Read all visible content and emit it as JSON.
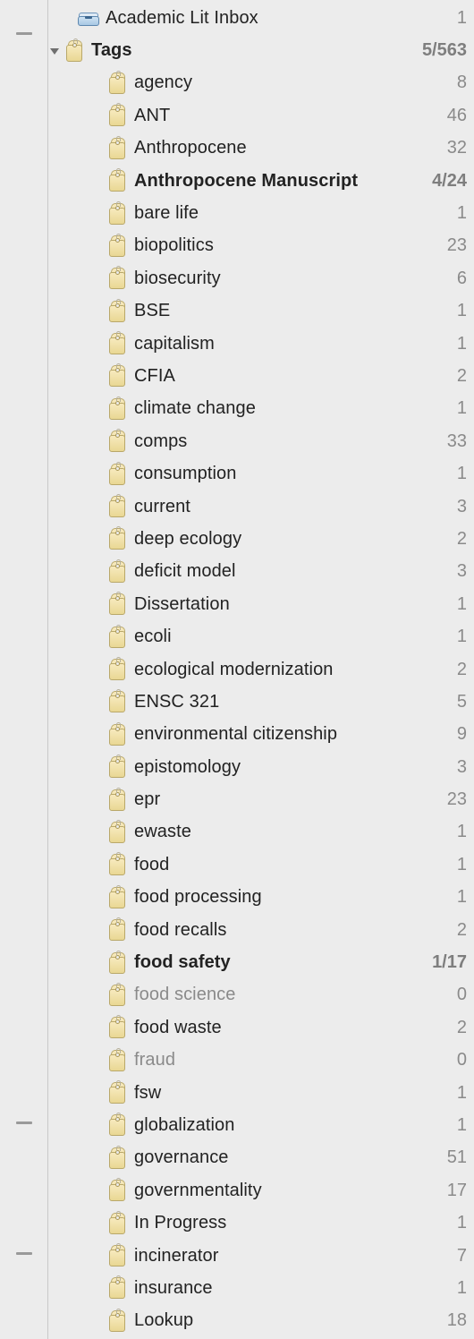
{
  "inboxRow": {
    "label": "Academic Lit Inbox",
    "count": "1",
    "iconName": "inbox-icon"
  },
  "tagsHeader": {
    "label": "Tags",
    "count": "5/563",
    "iconName": "tag-icon",
    "bold": true,
    "expanded": true
  },
  "tags": [
    {
      "label": "agency",
      "count": "8"
    },
    {
      "label": "ANT",
      "count": "46"
    },
    {
      "label": "Anthropocene",
      "count": "32"
    },
    {
      "label": "Anthropocene Manuscript",
      "count": "4/24",
      "bold": true
    },
    {
      "label": "bare life",
      "count": "1"
    },
    {
      "label": "biopolitics",
      "count": "23"
    },
    {
      "label": "biosecurity",
      "count": "6"
    },
    {
      "label": "BSE",
      "count": "1"
    },
    {
      "label": "capitalism",
      "count": "1"
    },
    {
      "label": "CFIA",
      "count": "2"
    },
    {
      "label": "climate change",
      "count": "1"
    },
    {
      "label": "comps",
      "count": "33"
    },
    {
      "label": "consumption",
      "count": "1"
    },
    {
      "label": "current",
      "count": "3"
    },
    {
      "label": "deep ecology",
      "count": "2"
    },
    {
      "label": "deficit model",
      "count": "3"
    },
    {
      "label": "Dissertation",
      "count": "1"
    },
    {
      "label": "ecoli",
      "count": "1"
    },
    {
      "label": "ecological modernization",
      "count": "2"
    },
    {
      "label": "ENSC 321",
      "count": "5"
    },
    {
      "label": "environmental citizenship",
      "count": "9"
    },
    {
      "label": "epistomology",
      "count": "3"
    },
    {
      "label": "epr",
      "count": "23"
    },
    {
      "label": "ewaste",
      "count": "1"
    },
    {
      "label": "food",
      "count": "1"
    },
    {
      "label": "food processing",
      "count": "1"
    },
    {
      "label": "food recalls",
      "count": "2"
    },
    {
      "label": "food safety",
      "count": "1/17",
      "bold": true
    },
    {
      "label": "food science",
      "count": "0",
      "dim": true
    },
    {
      "label": "food waste",
      "count": "2"
    },
    {
      "label": "fraud",
      "count": "0",
      "dim": true
    },
    {
      "label": "fsw",
      "count": "1"
    },
    {
      "label": "globalization",
      "count": "1"
    },
    {
      "label": "governance",
      "count": "51"
    },
    {
      "label": "governmentality",
      "count": "17"
    },
    {
      "label": "In Progress",
      "count": "1"
    },
    {
      "label": "incinerator",
      "count": "7"
    },
    {
      "label": "insurance",
      "count": "1"
    },
    {
      "label": "Lookup",
      "count": "18"
    }
  ],
  "gutterDashes": [
    36,
    1253,
    1399
  ]
}
